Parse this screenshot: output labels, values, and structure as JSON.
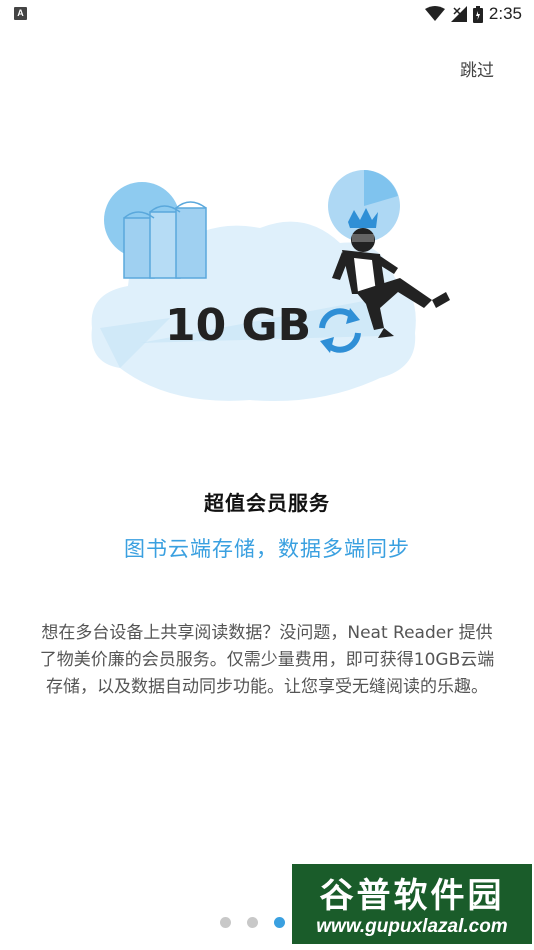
{
  "status_bar": {
    "left_icon": "A",
    "time": "2:35",
    "icons": [
      "wifi-icon",
      "signal-icon",
      "battery-icon"
    ]
  },
  "skip_label": "跳过",
  "illustration": {
    "storage_text": "10 GB",
    "icons": [
      "cloud-icon",
      "books-icon",
      "sync-icon",
      "person-icon",
      "crown-icon"
    ]
  },
  "title": "超值会员服务",
  "subtitle": "图书云端存储，数据多端同步",
  "description": "想在多台设备上共享阅读数据？没问题，Neat Reader 提供了物美价廉的会员服务。仅需少量费用，即可获得10GB云端存储，以及数据自动同步功能。让您享受无缝阅读的乐趣。",
  "pager": {
    "current": 3
  },
  "watermark": {
    "title": "谷普软件园",
    "url": "www.gupuxlazal.com"
  },
  "colors": {
    "accent": "#3aa0e0",
    "cloud": "#dff0fb",
    "dot_inactive": "#c8c8c8"
  }
}
